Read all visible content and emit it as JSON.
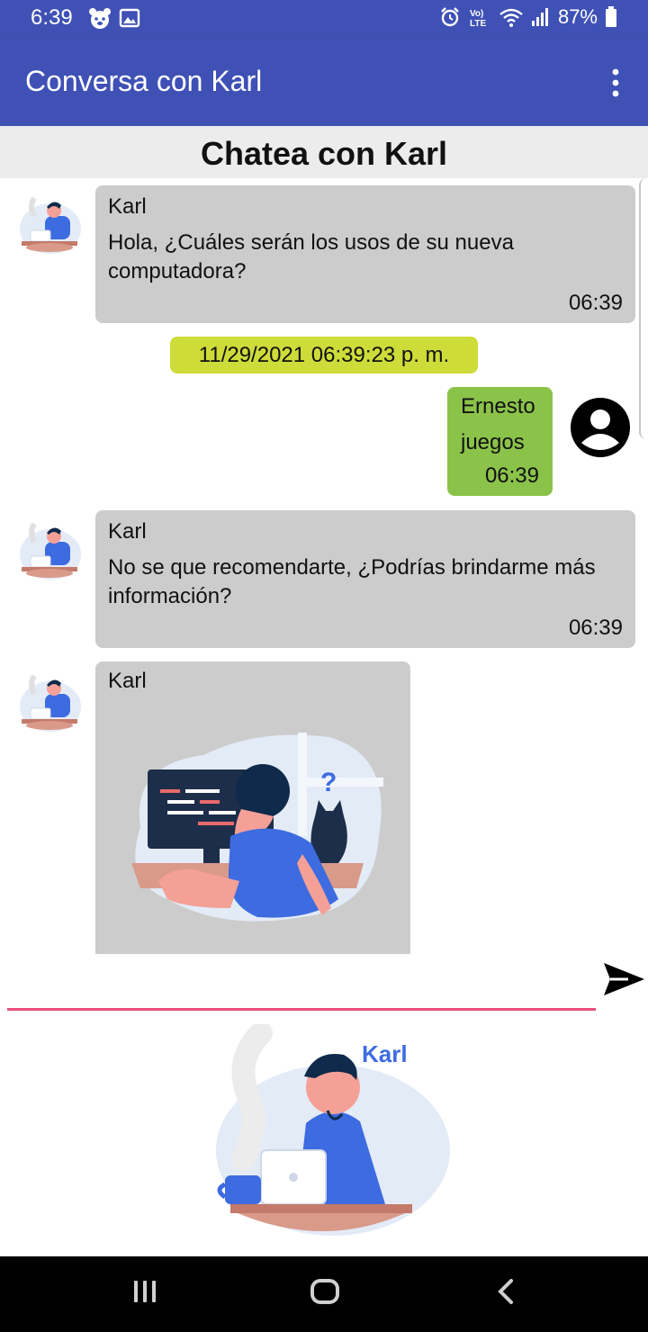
{
  "status_bar": {
    "time": "6:39",
    "battery": "87%",
    "icons": [
      "bear-notification-icon",
      "image-notification-icon",
      "alarm-icon",
      "volte-icon",
      "wifi-icon",
      "signal-icon",
      "battery-icon"
    ]
  },
  "app_bar": {
    "title": "Conversa con Karl",
    "menu_icon": "more-vert-icon"
  },
  "chat_header": {
    "title": "Chatea con Karl"
  },
  "messages": [
    {
      "sender": "Karl",
      "text": "Hola, ¿Cuáles serán los usos de su nueva computadora?",
      "time": "06:39",
      "side": "left"
    },
    {
      "date_chip": "11/29/2021 06:39:23 p. m."
    },
    {
      "sender": "Ernesto",
      "text": "juegos",
      "time": "06:39",
      "side": "right"
    },
    {
      "sender": "Karl",
      "text": "No se que recomendarte, ¿Podrías brindarme más información?",
      "time": "06:39",
      "side": "left"
    },
    {
      "sender": "Karl",
      "type": "image",
      "image": "developer-confused-illustration",
      "side": "left"
    }
  ],
  "input": {
    "value": "",
    "placeholder": "",
    "send_icon": "send-icon"
  },
  "bottom_image": {
    "label": "Karl"
  },
  "colors": {
    "primary": "#3f51b5",
    "bot_bubble": "#cccccc",
    "user_bubble": "#8bc34a",
    "date_chip": "#cddc39",
    "input_underline": "#e94f7a"
  }
}
